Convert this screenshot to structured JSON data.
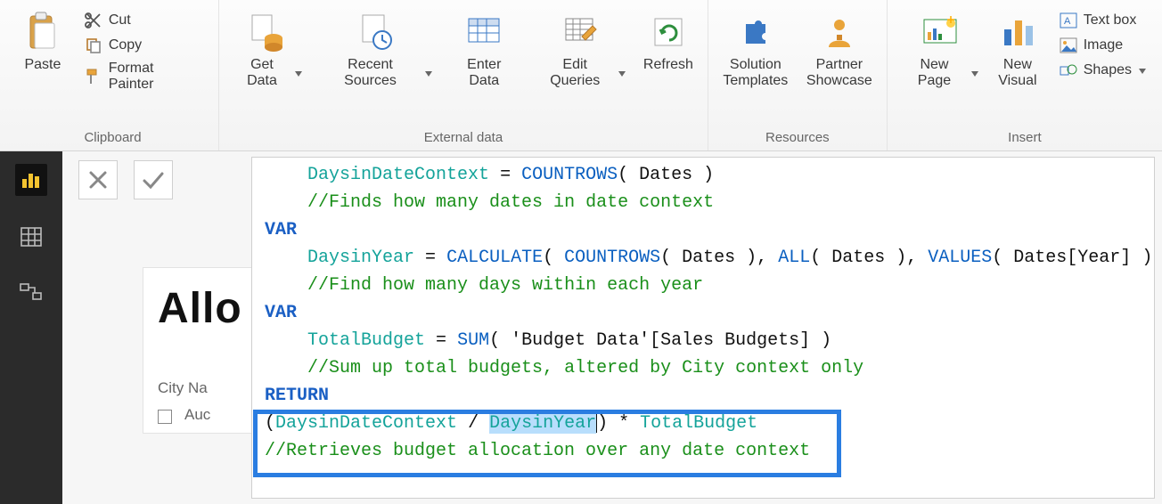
{
  "ribbon": {
    "clipboard": {
      "paste": "Paste",
      "cut": "Cut",
      "copy": "Copy",
      "format_painter": "Format Painter",
      "group": "Clipboard"
    },
    "external": {
      "get_data": "Get Data",
      "recent_sources": "Recent Sources",
      "enter_data": "Enter Data",
      "edit_queries": "Edit Queries",
      "refresh": "Refresh",
      "group": "External data"
    },
    "resources": {
      "solution_templates": "Solution Templates",
      "partner_showcase": "Partner Showcase",
      "group": "Resources"
    },
    "insert": {
      "new_page": "New Page",
      "new_visual": "New Visual",
      "text_box": "Text box",
      "image": "Image",
      "shapes": "Shapes",
      "group": "Insert"
    }
  },
  "report": {
    "title_truncated": "Allo",
    "field_label": "City Na",
    "field_item": "Auc"
  },
  "formula": {
    "l1a": "DaysinDateContext",
    "l1b": "COUNTROWS",
    "l1c": "Dates",
    "l2": "//Finds how many dates in date context",
    "l3": "VAR",
    "l4a": "DaysinYear",
    "l4b": "CALCULATE",
    "l4c": "COUNTROWS",
    "l4d": "Dates",
    "l4e": "ALL",
    "l4f": "Dates",
    "l4g": "VALUES",
    "l4h": "Dates[Year]",
    "l5": "//Find how many days within each year",
    "l6": "VAR",
    "l7a": "TotalBudget",
    "l7b": "SUM",
    "l7c": "'Budget Data'[Sales Budgets]",
    "l8": "//Sum up total budgets, altered by City context only",
    "l9": "RETURN",
    "l10a": "DaysinDateContext",
    "l10b": "DaysinYear",
    "l10c": "TotalBudget",
    "l11": "//Retrieves budget allocation over any date context"
  }
}
